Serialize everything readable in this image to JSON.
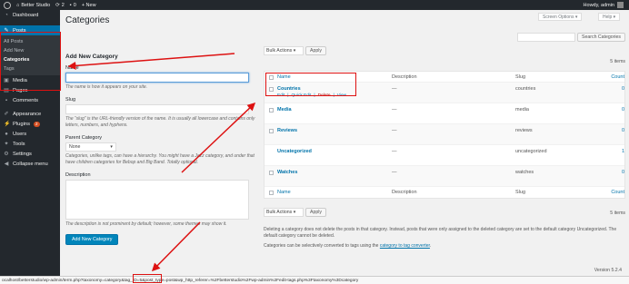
{
  "adminbar": {
    "site_name": "Better Studio",
    "updates_count": "2",
    "comments_count": "0",
    "new_label": "+ New",
    "howdy": "Howdy, admin"
  },
  "sidebar": {
    "items": [
      {
        "label": "Dashboard",
        "icon": "dashboard-icon"
      },
      {
        "label": "Posts",
        "icon": "pin-icon"
      },
      {
        "label": "Media",
        "icon": "media-icon"
      },
      {
        "label": "Pages",
        "icon": "page-icon"
      },
      {
        "label": "Comments",
        "icon": "comment-icon"
      },
      {
        "label": "Appearance",
        "icon": "brush-icon"
      },
      {
        "label": "Plugins",
        "icon": "plug-icon",
        "badge": "2"
      },
      {
        "label": "Users",
        "icon": "user-icon"
      },
      {
        "label": "Tools",
        "icon": "wrench-icon"
      },
      {
        "label": "Settings",
        "icon": "settings-icon"
      },
      {
        "label": "Collapse menu",
        "icon": "collapse-icon"
      }
    ],
    "posts_submenu": [
      "All Posts",
      "Add New",
      "Categories",
      "Tags"
    ]
  },
  "header": {
    "title": "Categories",
    "screen_options": "Screen Options ▾",
    "help": "Help ▾"
  },
  "form": {
    "heading": "Add New Category",
    "name_label": "Name",
    "name_desc": "The name is how it appears on your site.",
    "slug_label": "Slug",
    "slug_desc": "The “slug” is the URL-friendly version of the name. It is usually all lowercase and contains only letters, numbers, and hyphens.",
    "parent_label": "Parent Category",
    "parent_value": "None",
    "parent_desc": "Categories, unlike tags, can have a hierarchy. You might have a Jazz category, and under that have children categories for Bebop and Big Band. Totally optional.",
    "description_label": "Description",
    "description_desc": "The description is not prominent by default; however, some themes may show it.",
    "submit": "Add New Category"
  },
  "list": {
    "search_button": "Search Categories",
    "bulk_actions": "Bulk Actions ▾",
    "apply": "Apply",
    "items_count": "5 items",
    "columns": {
      "name": "Name",
      "description": "Description",
      "slug": "Slug",
      "count": "Count"
    },
    "rows": [
      {
        "name": "Countries",
        "description": "—",
        "slug": "countries",
        "count": "0"
      },
      {
        "name": "Media",
        "description": "—",
        "slug": "media",
        "count": "0"
      },
      {
        "name": "Reviews",
        "description": "—",
        "slug": "reviews",
        "count": "0"
      },
      {
        "name": "Uncategorized",
        "description": "—",
        "slug": "uncategorized",
        "count": "1"
      },
      {
        "name": "Watches",
        "description": "—",
        "slug": "watches",
        "count": "0"
      }
    ],
    "row_actions": {
      "edit": "Edit",
      "quick_edit": "Quick Edit",
      "delete": "Delete",
      "view": "View"
    },
    "note1": "Deleting a category does not delete the posts in that category. Instead, posts that were only assigned to the deleted category are set to the default category Uncategorized. The default category cannot be deleted.",
    "note2_prefix": "Categories can be selectively converted to tags using the ",
    "note2_link": "category to tag converter",
    "note2_suffix": "."
  },
  "footer": {
    "version": "Version 5.2.4",
    "status_url": "ocalhost/betterstudio/wp-admin/term.php?taxonomy=category&tag_ID=5&post_type=post&wp_http_referer=%2Fbetterstudio%2Fwp-admin%2Fedit-tags.php%3Ftaxonomy%3Dcategory"
  },
  "colors": {
    "admin_dark": "#23282d",
    "accent": "#0073aa",
    "annotation_red": "#d11"
  }
}
